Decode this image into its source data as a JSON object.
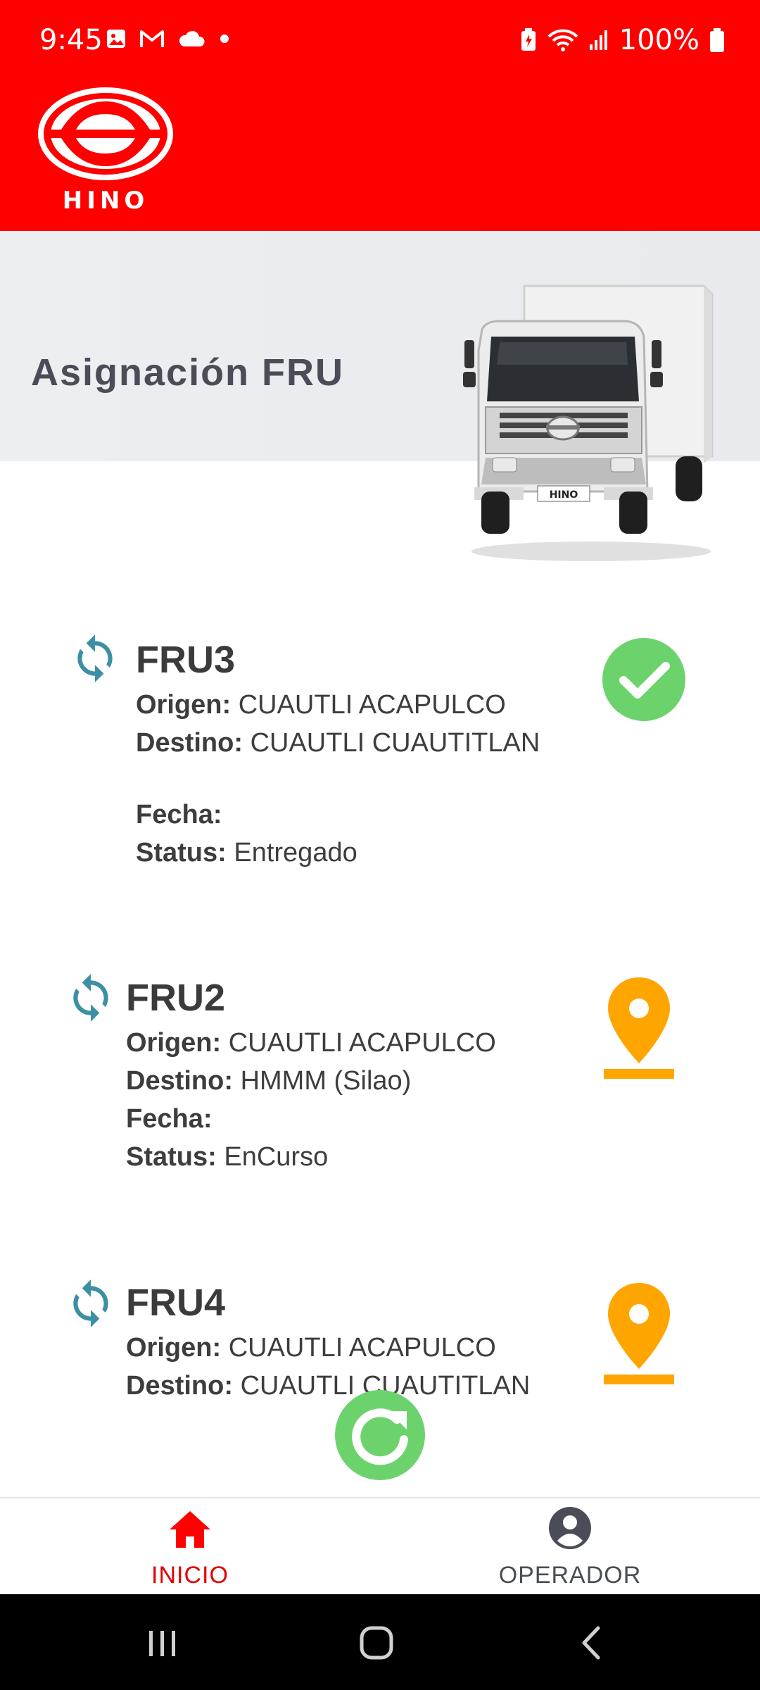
{
  "status_bar": {
    "time": "9:45",
    "battery": "100%",
    "left_icons": [
      "gallery-icon",
      "gmail-icon",
      "cloud-icon",
      "dot-icon"
    ],
    "right_icons": [
      "battery-saver-icon",
      "wifi-icon",
      "signal-icon",
      "battery-icon"
    ]
  },
  "app": {
    "logo_text": "HINO"
  },
  "hero": {
    "title": "Asignación FRU"
  },
  "cards": [
    {
      "title": "FRU3",
      "origin_label": "Origen:",
      "origin": "CUAUTLI ACAPULCO",
      "dest_label": "Destino:",
      "dest": "CUAUTLI CUAUTITLAN",
      "date_label": "Fecha:",
      "date": "",
      "status_label": "Status:",
      "status": "Entregado",
      "status_icon": "check-circle-icon"
    },
    {
      "title": "FRU2",
      "origin_label": "Origen:",
      "origin": "CUAUTLI ACAPULCO",
      "dest_label": "Destino:",
      "dest": "HMMM (Silao)",
      "date_label": "Fecha:",
      "date": "",
      "status_label": "Status:",
      "status": "EnCurso",
      "status_icon": "location-pin-icon"
    },
    {
      "title": "FRU4",
      "origin_label": "Origen:",
      "origin": "CUAUTLI ACAPULCO",
      "dest_label": "Destino:",
      "dest": "CUAUTLI CUAUTITLAN",
      "status_icon": "location-pin-icon"
    }
  ],
  "bottom_nav": {
    "home_label": "INICIO",
    "operator_label": "OPERADOR"
  },
  "colors": {
    "brand_red": "#fe0000",
    "check_green": "#6cd36c",
    "pin_orange": "#ffa500",
    "sync_blue": "#3d8fa3",
    "nav_inactive": "#4a4d57"
  }
}
